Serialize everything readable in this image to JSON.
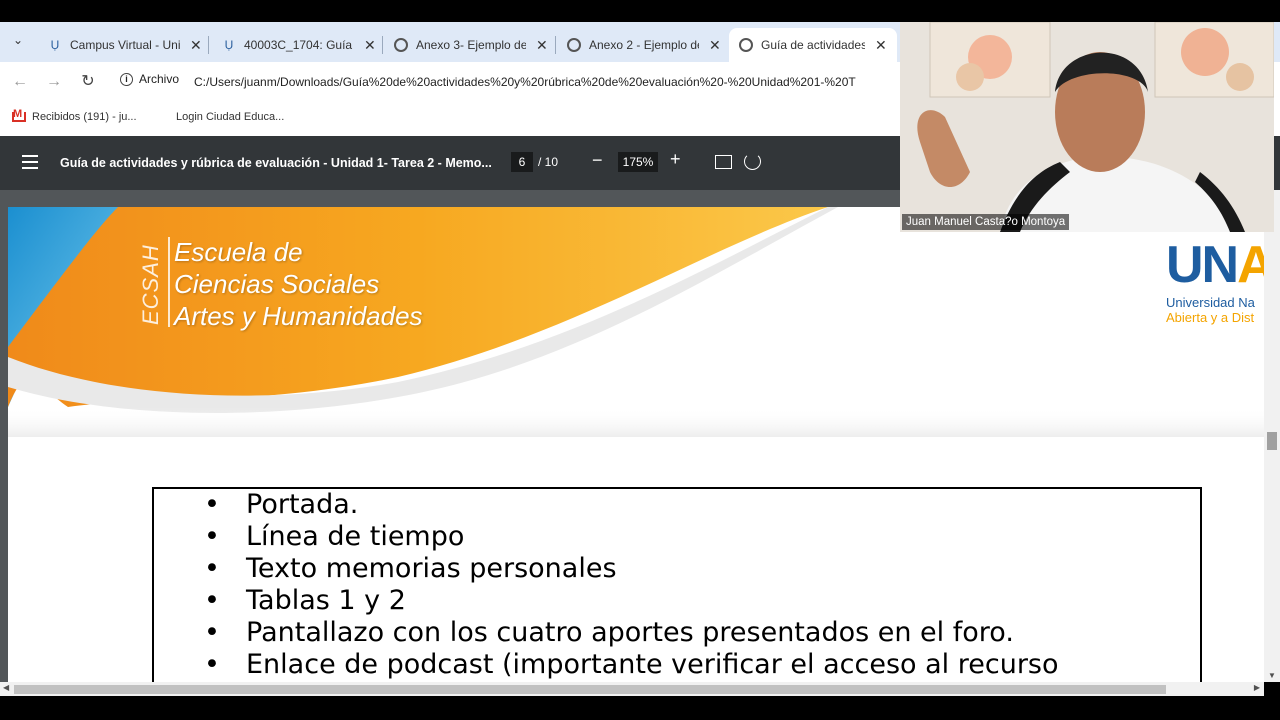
{
  "browser": {
    "tabs": [
      {
        "title": "Campus Virtual - Uni",
        "icon": "unad-favicon"
      },
      {
        "title": "40003C_1704: Guía d",
        "icon": "unad-favicon"
      },
      {
        "title": "Anexo 3- Ejemplo de",
        "icon": "globe-icon"
      },
      {
        "title": "Anexo 2 - Ejemplo de",
        "icon": "globe-icon"
      },
      {
        "title": "Guía de actividades y",
        "icon": "globe-icon",
        "active": true
      }
    ],
    "site_label": "Archivo",
    "url": "C:/Users/juanm/Downloads/Guía%20de%20actividades%20y%20rúbrica%20de%20evaluación%20-%20Unidad%201-%20T",
    "bookmarks": [
      "Recibidos (191) - ju...",
      "Login Ciudad Educa..."
    ]
  },
  "pdf_viewer": {
    "title": "Guía de actividades y rúbrica de evaluación - Unidad 1- Tarea 2 - Memo...",
    "current_page": "6",
    "total_pages": "/ 10",
    "zoom": "175%"
  },
  "document": {
    "banner_vertical": "ECSAH",
    "banner_lines": [
      "Escuela de",
      "Ciencias Sociales",
      "Artes y Humanidades"
    ],
    "logo_letters": "UNA",
    "logo_sub1": "Universidad Na",
    "logo_sub2": "Abierta y a Dist",
    "list_items": [
      "Portada.",
      "Línea de tiempo",
      "Texto memorias personales",
      "Tablas 1 y 2",
      "Pantallazo con los cuatro aportes presentados en el foro.",
      "Enlace de podcast (importante verificar el acceso al recurso"
    ]
  },
  "webcam": {
    "participant_name": "Juan Manuel Casta?o Montoya"
  },
  "colors": {
    "tabstrip": "#dfe9f7",
    "pdf_toolbar": "#323639",
    "banner_orange": "#f39c12",
    "banner_blue": "#2aa0d8",
    "unad_blue": "#1e5da0",
    "unad_orange": "#f4a400"
  }
}
